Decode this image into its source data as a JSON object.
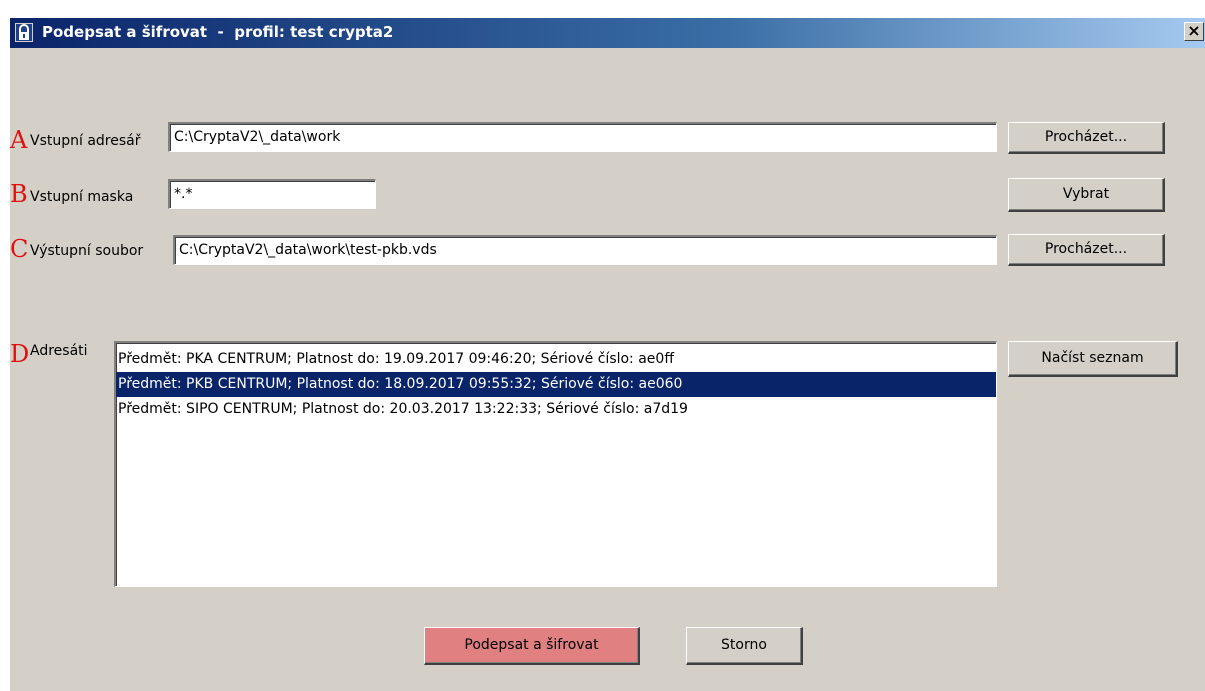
{
  "window": {
    "title": "Podepsat a šifrovat  -  profil: test crypta2",
    "close_label": "×"
  },
  "annotations": [
    "A",
    "B",
    "C",
    "D"
  ],
  "form": {
    "input_dir": {
      "label": "Vstupní adresář",
      "value": "C:\\CryptaV2\\_data\\work",
      "button": "Procházet..."
    },
    "input_mask": {
      "label": "Vstupní maska",
      "value": "*.*",
      "button": "Vybrat"
    },
    "output_file": {
      "label": "Výstupní soubor",
      "value": "C:\\CryptaV2\\_data\\work\\test-pkb.vds",
      "button": "Procházet..."
    },
    "recipients": {
      "label": "Adresáti",
      "button": "Načíst seznam",
      "items": [
        {
          "text": "Předmět: PKA CENTRUM; Platnost do: 19.09.2017 09:46:20; Sériové číslo: ae0ff",
          "selected": false
        },
        {
          "text": "Předmět: PKB CENTRUM; Platnost do: 18.09.2017 09:55:32; Sériové číslo: ae060",
          "selected": true
        },
        {
          "text": "Předmět: SIPO CENTRUM; Platnost do: 20.03.2017 13:22:33; Sériové číslo: a7d19",
          "selected": false
        }
      ]
    }
  },
  "footer": {
    "submit_label": "Podepsat a šifrovat",
    "cancel_label": "Storno"
  }
}
